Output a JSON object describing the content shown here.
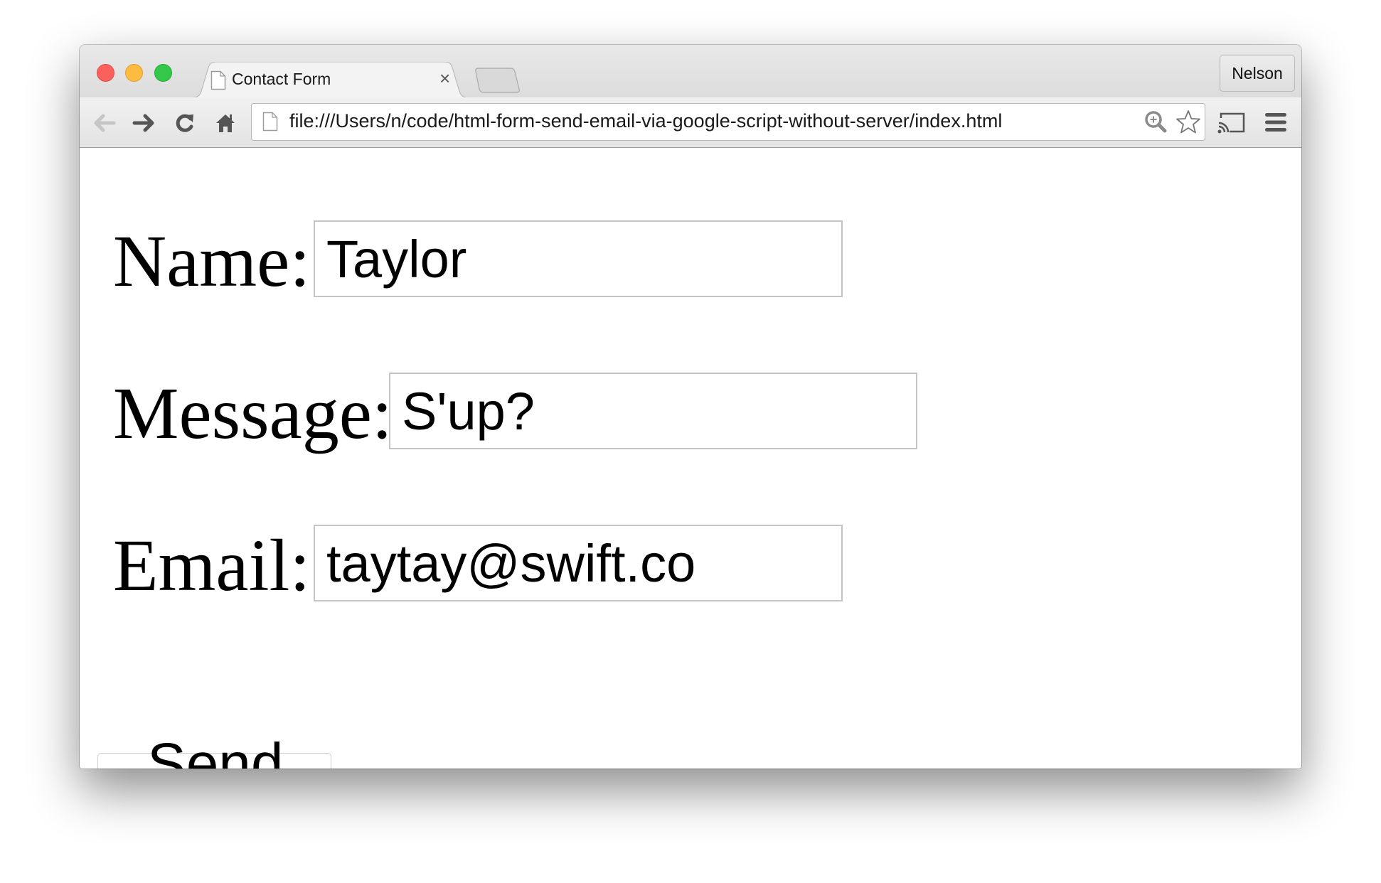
{
  "browser": {
    "tab": {
      "title": "Contact Form",
      "close_glyph": "×",
      "icon": "page-icon"
    },
    "profile_button": "Nelson",
    "address_bar": {
      "url": "file:///Users/n/code/html-form-send-email-via-google-script-without-server/index.html"
    },
    "toolbar_icons": [
      "back-icon",
      "forward-icon",
      "reload-icon",
      "home-icon",
      "zoom-icon",
      "star-icon",
      "cast-icon",
      "menu-icon"
    ],
    "window_controls": {
      "close": "#fc605c",
      "minimize": "#fdbc40",
      "maximize": "#34c84a"
    }
  },
  "form": {
    "name": {
      "label": "Name:",
      "value": "Taylor"
    },
    "message": {
      "label": "Message:",
      "value": "S'up?"
    },
    "email": {
      "label": "Email:",
      "value": "taytay@swift.co"
    },
    "submit_label": "Send"
  }
}
